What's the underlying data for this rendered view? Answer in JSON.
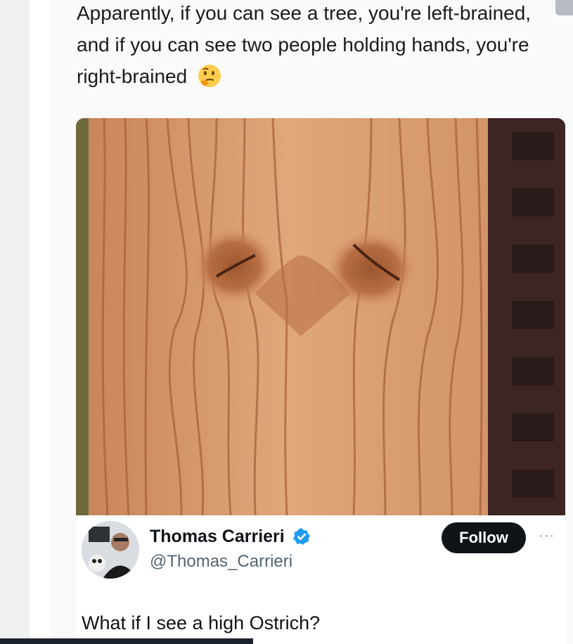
{
  "post": {
    "text": "Apparently, if you can see a tree, you're left-brained, and if you can see two people holding hands, you're right-brained",
    "emoji": "thinking-face-icon"
  },
  "tweet": {
    "author_name": "Thomas Carrieri",
    "author_handle": "@Thomas_Carrieri",
    "follow_label": "Follow",
    "more_label": "···",
    "reply_text": "What if I see a high Ostrich?"
  },
  "colors": {
    "follow_bg": "#0f1419",
    "verified": "#1d9bf0",
    "wood": "#d89a6c"
  }
}
